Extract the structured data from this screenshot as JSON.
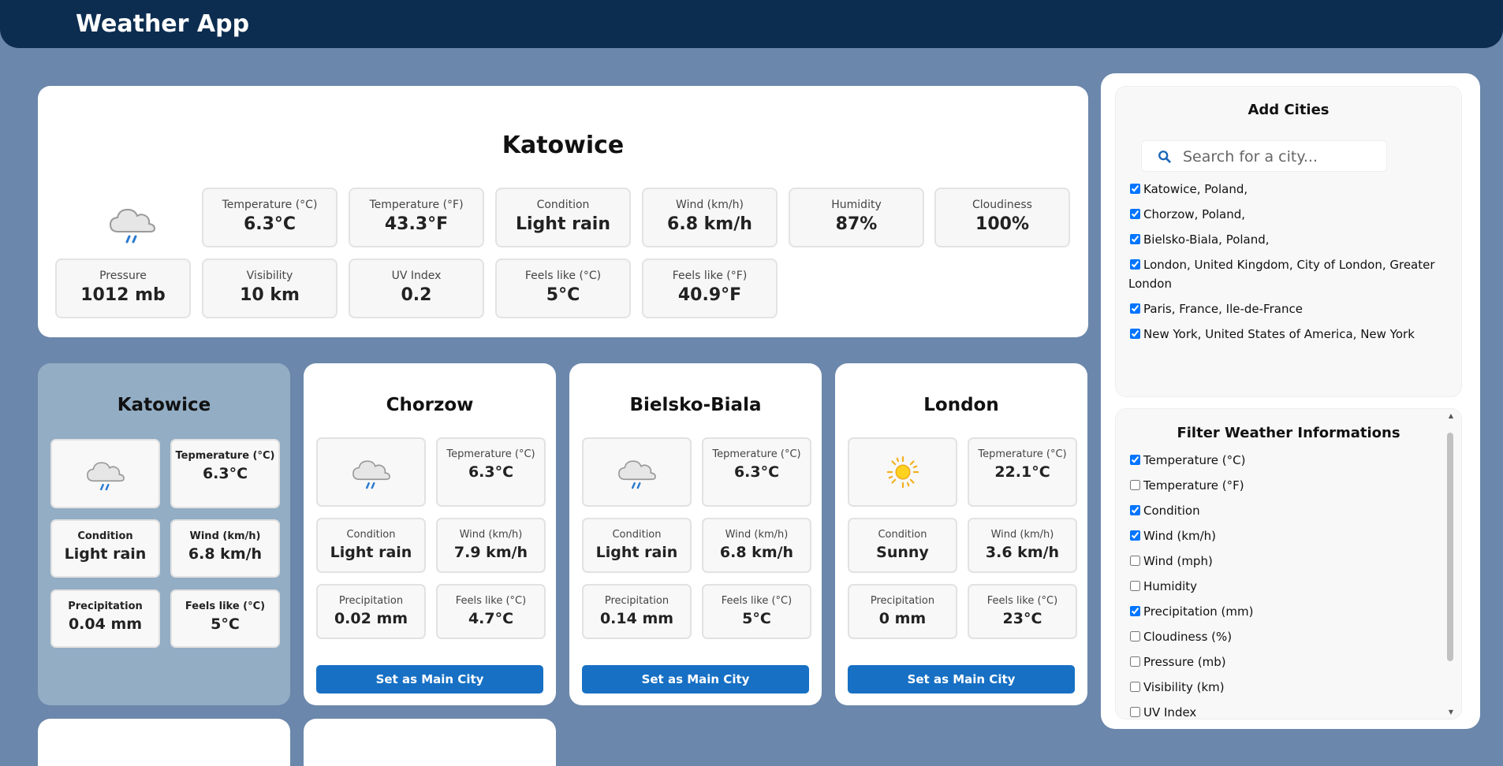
{
  "app": {
    "title": "Weather App"
  },
  "main_city": {
    "name": "Katowice",
    "icon": "cloud-rain-icon",
    "tiles": [
      {
        "label": "Temperature (°C)",
        "value": "6.3°C"
      },
      {
        "label": "Temperature (°F)",
        "value": "43.3°F"
      },
      {
        "label": "Condition",
        "value": "Light rain"
      },
      {
        "label": "Wind (km/h)",
        "value": "6.8 km/h"
      },
      {
        "label": "Humidity",
        "value": "87%"
      },
      {
        "label": "Cloudiness",
        "value": "100%"
      },
      {
        "label": "Pressure",
        "value": "1012 mb"
      },
      {
        "label": "Visibility",
        "value": "10 km"
      },
      {
        "label": "UV Index",
        "value": "0.2"
      },
      {
        "label": "Feels like (°C)",
        "value": "5°C"
      },
      {
        "label": "Feels like (°F)",
        "value": "40.9°F"
      }
    ]
  },
  "cards": [
    {
      "name": "Katowice",
      "icon": "cloud-rain-icon",
      "temp_label": "Tepmerature (°C)",
      "temp": "6.3°C",
      "cond_label": "Condition",
      "cond": "Light rain",
      "wind_label": "Wind (km/h)",
      "wind": "6.8 km/h",
      "precip_label": "Precipitation",
      "precip": "0.04 mm",
      "feels_label": "Feels like (°C)",
      "feels": "5°C"
    },
    {
      "name": "Chorzow",
      "icon": "cloud-rain-icon",
      "temp_label": "Tepmerature (°C)",
      "temp": "6.3°C",
      "cond_label": "Condition",
      "cond": "Light rain",
      "wind_label": "Wind (km/h)",
      "wind": "7.9 km/h",
      "precip_label": "Precipitation",
      "precip": "0.02 mm",
      "feels_label": "Feels like (°C)",
      "feels": "4.7°C",
      "button": "Set as Main City"
    },
    {
      "name": "Bielsko-Biala",
      "icon": "cloud-rain-icon",
      "temp_label": "Tepmerature (°C)",
      "temp": "6.3°C",
      "cond_label": "Condition",
      "cond": "Light rain",
      "wind_label": "Wind (km/h)",
      "wind": "6.8 km/h",
      "precip_label": "Precipitation",
      "precip": "0.14 mm",
      "feels_label": "Feels like (°C)",
      "feels": "5°C",
      "button": "Set as Main City"
    },
    {
      "name": "London",
      "icon": "sun-icon",
      "temp_label": "Tepmerature (°C)",
      "temp": "22.1°C",
      "cond_label": "Condition",
      "cond": "Sunny",
      "wind_label": "Wind (km/h)",
      "wind": "3.6 km/h",
      "precip_label": "Precipitation",
      "precip": "0 mm",
      "feels_label": "Feels like (°C)",
      "feels": "23°C",
      "button": "Set as Main City"
    }
  ],
  "add_cities": {
    "title": "Add Cities",
    "search_placeholder": "Search for a city...",
    "items": [
      {
        "label": "Katowice, Poland,",
        "checked": true
      },
      {
        "label": "Chorzow, Poland,",
        "checked": true
      },
      {
        "label": "Bielsko-Biala, Poland,",
        "checked": true
      },
      {
        "label": "London, United Kingdom, City of London, Greater London",
        "checked": true
      },
      {
        "label": "Paris, France, Ile-de-France",
        "checked": true
      },
      {
        "label": "New York, United States of America, New York",
        "checked": true
      }
    ]
  },
  "filter": {
    "title": "Filter Weather Informations",
    "items": [
      {
        "label": "Temperature (°C)",
        "checked": true
      },
      {
        "label": "Temperature (°F)",
        "checked": false
      },
      {
        "label": "Condition",
        "checked": true
      },
      {
        "label": "Wind (km/h)",
        "checked": true
      },
      {
        "label": "Wind (mph)",
        "checked": false
      },
      {
        "label": "Humidity",
        "checked": false
      },
      {
        "label": "Precipitation (mm)",
        "checked": true
      },
      {
        "label": "Cloudiness (%)",
        "checked": false
      },
      {
        "label": "Pressure (mb)",
        "checked": false
      },
      {
        "label": "Visibility (km)",
        "checked": false
      },
      {
        "label": "UV Index",
        "checked": false
      }
    ]
  },
  "colors": {
    "header_bg": "#0c2d50",
    "page_bg": "#6b87ab",
    "active_card_bg": "#92adc4",
    "button_bg": "#1770c4"
  }
}
